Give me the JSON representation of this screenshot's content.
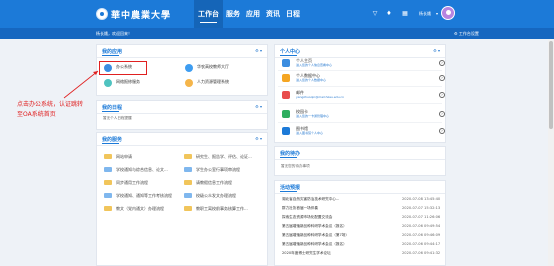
{
  "header": {
    "logo_text": "華中農業大學",
    "nav": [
      "工作台",
      "服务",
      "应用",
      "资讯",
      "日程"
    ],
    "user_name": "杨长娥"
  },
  "subbar": {
    "welcome": "杨长娥，欢迎回来！",
    "settings": "工作台设置"
  },
  "my_apps": {
    "title": "我的应用",
    "apps": [
      {
        "name": "办公系统",
        "sub": ""
      },
      {
        "name": "华农高校教师大厅",
        "sub": ""
      },
      {
        "name": "网络报修服务",
        "sub": ""
      },
      {
        "name": "人力资源管理系统",
        "sub": ""
      }
    ]
  },
  "my_schedule": {
    "title": "我的日程",
    "empty": "暂无个人日程提醒"
  },
  "my_services": {
    "title": "我的服务",
    "items": [
      "网站申请",
      "研究生、报告学、评估、论证...",
      "学校通知与综合信息、论文...",
      "学生办公室行事项审流程",
      "同步通用工作流程",
      "请教假信息工作流程",
      "学校通知、通知等工作考核流程",
      "校级公众发文办理流程",
      "教文（党内通文）办理流程",
      "教职工离校前事务核算工作..."
    ]
  },
  "personal_center": {
    "title": "个人中心",
    "items": [
      {
        "title": "个人主页",
        "sub": "进入您的个人信息查看中心"
      },
      {
        "title": "个人数据中心",
        "sub": "进入您的个人数据中心"
      },
      {
        "title": "邮件",
        "sub": "yangzhuoqin@mail.hzau.edu.cn"
      },
      {
        "title": "校园卡",
        "sub": "进入您的一卡通管理中心"
      },
      {
        "title": "图书馆",
        "sub": "进入图书馆个人中心"
      }
    ]
  },
  "my_todo": {
    "title": "我的待办",
    "empty": "暂无您的待办事项"
  },
  "activities": {
    "title": "活动预报",
    "items": [
      {
        "title": "湖北省自然灾害防治技术研究中心...",
        "date": "2020-07-08 13:45:40"
      },
      {
        "title": "群力社协首届一场伴奏",
        "date": "2020-07-07 15:32:13"
      },
      {
        "title": "探索生态资源市场化配置交流会",
        "date": "2020-07-07 11:26:06"
      },
      {
        "title": "第五届增殖新品种科研学术会议（报名）",
        "date": "2020-07-06 09:49:54"
      },
      {
        "title": "第五届增殖新品种科研学术会议（第7场）",
        "date": "2020-07-06 09:46:09"
      },
      {
        "title": "第五届增殖新品种科研学术会议（报名）",
        "date": "2020-07-06 09:44:17"
      },
      {
        "title": "2020年度博士研究生学术论坛",
        "date": "2020-07-06 09:41:32"
      }
    ]
  },
  "annotation": {
    "line1": "点击办公系统，认证跳转",
    "line2": "至OA系统首页"
  },
  "colors": {
    "brand": "#1c7ad8",
    "annotation": "#e02020"
  }
}
